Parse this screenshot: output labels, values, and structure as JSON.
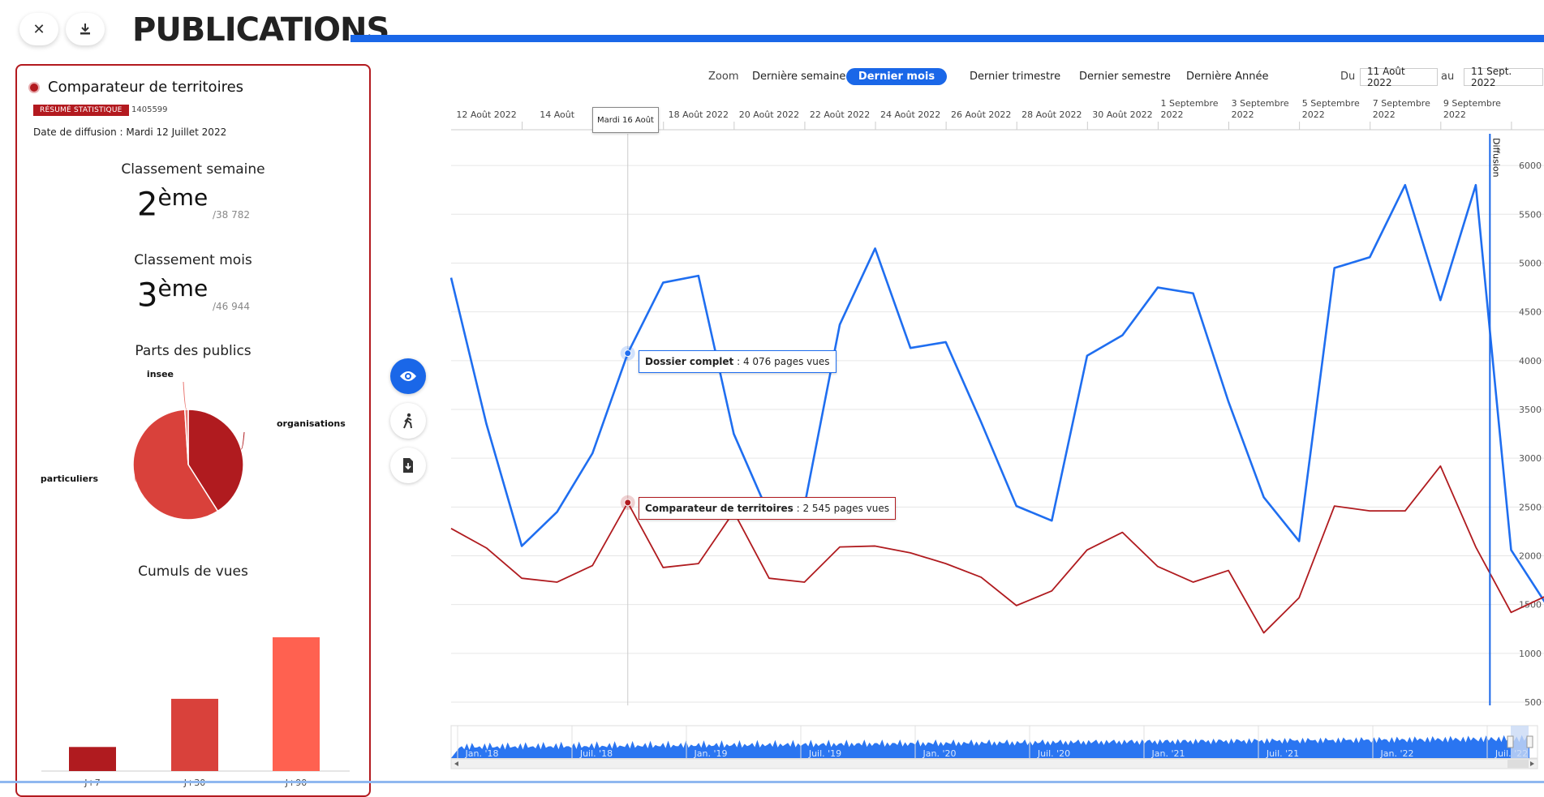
{
  "header": {
    "title": "PUBLICATIONS",
    "close_icon": "close-icon",
    "download_icon": "download-icon"
  },
  "panel": {
    "title": "Comparateur de territoires",
    "badge": "RÉSUMÉ STATISTIQUE",
    "id": "1405599",
    "date": "Date de diffusion : Mardi 12 Juillet 2022",
    "rank_week": {
      "title": "Classement semaine",
      "value": "2",
      "suffix": "ème",
      "total": "/38 782"
    },
    "rank_month": {
      "title": "Classement mois",
      "value": "3",
      "suffix": "ème",
      "total": "/46 944"
    },
    "publics": {
      "title": "Parts des publics",
      "slices": [
        {
          "label": "organisations",
          "value": 41,
          "color": "#b01b1f"
        },
        {
          "label": "particuliers",
          "value": 58,
          "color": "#d9413b"
        },
        {
          "label": "insee",
          "value": 1,
          "color": "#e8736e"
        }
      ]
    },
    "cumuls": {
      "title": "Cumuls de vues",
      "categories": [
        "J+7",
        "J+30",
        "J+90"
      ],
      "values": [
        18,
        54,
        100
      ],
      "colors": [
        "#b01b1f",
        "#d9413b",
        "#ff6150"
      ]
    }
  },
  "zoom": {
    "label": "Zoom",
    "options": [
      "Dernière semaine",
      "Dernier mois",
      "Dernier trimestre",
      "Dernier semestre",
      "Dernière Année"
    ],
    "active": 1,
    "from_label": "Du",
    "from": "11 Août 2022",
    "to_label": "au",
    "to": "11 Sept. 2022"
  },
  "side_buttons": [
    "eye-icon",
    "walker-icon",
    "file-download-icon"
  ],
  "chart_data": {
    "type": "line",
    "x": [
      "11/08",
      "12/08",
      "13/08",
      "14/08",
      "15/08",
      "16/08",
      "17/08",
      "18/08",
      "19/08",
      "20/08",
      "21/08",
      "22/08",
      "23/08",
      "24/08",
      "25/08",
      "26/08",
      "27/08",
      "28/08",
      "29/08",
      "30/08",
      "31/08",
      "01/09",
      "02/09",
      "03/09",
      "04/09",
      "05/09",
      "06/09",
      "07/09",
      "08/09",
      "09/09",
      "10/09",
      "11/09"
    ],
    "x_ticks": [
      {
        "i": 1,
        "label": "12 Août 2022"
      },
      {
        "i": 3,
        "label": "14 Août"
      },
      {
        "i": 5,
        "label": "2022"
      },
      {
        "i": 7,
        "label": "18 Août 2022"
      },
      {
        "i": 9,
        "label": "20 Août 2022"
      },
      {
        "i": 11,
        "label": "22 Août 2022"
      },
      {
        "i": 13,
        "label": "24 Août 2022"
      },
      {
        "i": 15,
        "label": "26 Août 2022"
      },
      {
        "i": 17,
        "label": "28 Août 2022"
      },
      {
        "i": 19,
        "label": "30 Août 2022"
      },
      {
        "i": 21,
        "label": "1 Septembre 2022"
      },
      {
        "i": 23,
        "label": "3 Septembre 2022"
      },
      {
        "i": 25,
        "label": "5 Septembre 2022"
      },
      {
        "i": 27,
        "label": "7 Septembre 2022"
      },
      {
        "i": 29,
        "label": "9 Septembre 2022"
      }
    ],
    "series": [
      {
        "name": "Dossier complet",
        "color": "#1f6ef0",
        "values": [
          4850,
          3350,
          2100,
          2450,
          3050,
          4076,
          4800,
          4870,
          3250,
          2420,
          2510,
          4370,
          5150,
          4130,
          4190,
          3370,
          2510,
          2360,
          4050,
          4260,
          4750,
          4690,
          3580,
          2600,
          2150,
          4950,
          5060,
          5800,
          4620,
          5800,
          2060,
          1500
        ]
      },
      {
        "name": "Comparateur de territoires",
        "color": "#b01b1f",
        "values": [
          2280,
          2080,
          1770,
          1730,
          1900,
          2545,
          1880,
          1920,
          2450,
          1770,
          1730,
          2090,
          2100,
          2030,
          1920,
          1780,
          1490,
          1640,
          2060,
          2240,
          1890,
          1730,
          1850,
          1210,
          1570,
          2510,
          2460,
          2460,
          2920,
          2090,
          1420,
          1590
        ]
      }
    ],
    "yticks": [
      1000,
      1500,
      2000,
      2500,
      3000,
      3500,
      4000,
      4500,
      5000,
      5500,
      6000
    ],
    "ylim": [
      500,
      6400
    ],
    "hover_index": 5,
    "hover_label": "Mardi 16 Août",
    "tooltips": [
      {
        "series": "Dossier complet",
        "text": " : 4 076 pages vues"
      },
      {
        "series": "Comparateur de territoires",
        "text": " : 2 545 pages vues"
      }
    ],
    "plotline": {
      "index": 29.4,
      "label": "Diffusion"
    },
    "navigator_labels": [
      "Jan. '18",
      "Juil. '18",
      "Jan. '19",
      "Juil. '19",
      "Jan. '20",
      "Juil. '20",
      "Jan. '21",
      "Juil. '21",
      "Jan. '22",
      "Juil. '22"
    ]
  }
}
